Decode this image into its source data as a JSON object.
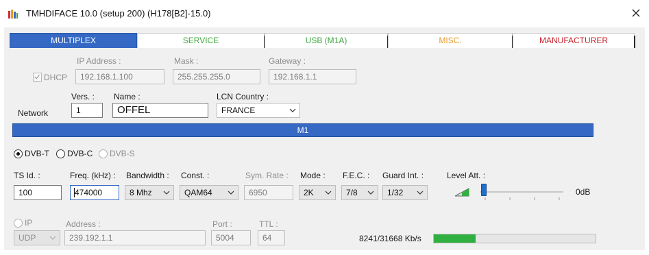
{
  "window": {
    "title": "TMHDIFACE 10.0 (setup 200) (H178[B2]-15.0)"
  },
  "tabs": [
    {
      "label": "MULTIPLEX",
      "color": "#ffffff",
      "active": true
    },
    {
      "label": "SERVICE",
      "color": "#3da83d",
      "active": false
    },
    {
      "label": "USB (M1A)",
      "color": "#3da83d",
      "active": false
    },
    {
      "label": "MISC.",
      "color": "#e89a2a",
      "active": false
    },
    {
      "label": "MANUFACTURER",
      "color": "#c8242b",
      "active": false
    }
  ],
  "network_cfg": {
    "dhcp_label": "DHCP",
    "dhcp_checked": true,
    "ip_label": "IP Address :",
    "ip_value": "192.168.1.100",
    "mask_label": "Mask :",
    "mask_value": "255.255.255.0",
    "gateway_label": "Gateway :",
    "gateway_value": "192.168.1.1"
  },
  "network": {
    "row_label": "Network",
    "vers_label": "Vers. :",
    "vers_value": "1",
    "name_label": "Name :",
    "name_value": "OFFEL",
    "lcn_label": "LCN Country :",
    "lcn_value": "FRANCE"
  },
  "multiplex_bar": {
    "label": "M1"
  },
  "modulation": {
    "dvbt_label": "DVB-T",
    "dvbc_label": "DVB-C",
    "dvbs_label": "DVB-S",
    "selected": "DVB-T"
  },
  "params": {
    "tsid_label": "TS Id. :",
    "tsid_value": "100",
    "freq_label": "Freq. (kHz) :",
    "freq_value": "474000",
    "bandwidth_label": "Bandwidth :",
    "bandwidth_value": "8 Mhz",
    "const_label": "Const. :",
    "const_value": "QAM64",
    "symrate_label": "Sym. Rate :",
    "symrate_value": "6950",
    "mode_label": "Mode :",
    "mode_value": "2K",
    "fec_label": "F.E.C. :",
    "fec_value": "7/8",
    "guard_label": "Guard Int. :",
    "guard_value": "1/32",
    "level_label": "Level Att. :",
    "level_value": "0dB"
  },
  "ip_output": {
    "ip_label": "IP",
    "protocol_value": "UDP",
    "address_label": "Address :",
    "address_value": "239.192.1.1",
    "port_label": "Port :",
    "port_value": "5004",
    "ttl_label": "TTL :",
    "ttl_value": "64"
  },
  "bitrate": {
    "text": "8241/31668 Kb/s",
    "fill_fraction": 0.26
  },
  "colors": {
    "accent": "#3569c4",
    "progress": "#30b040"
  }
}
